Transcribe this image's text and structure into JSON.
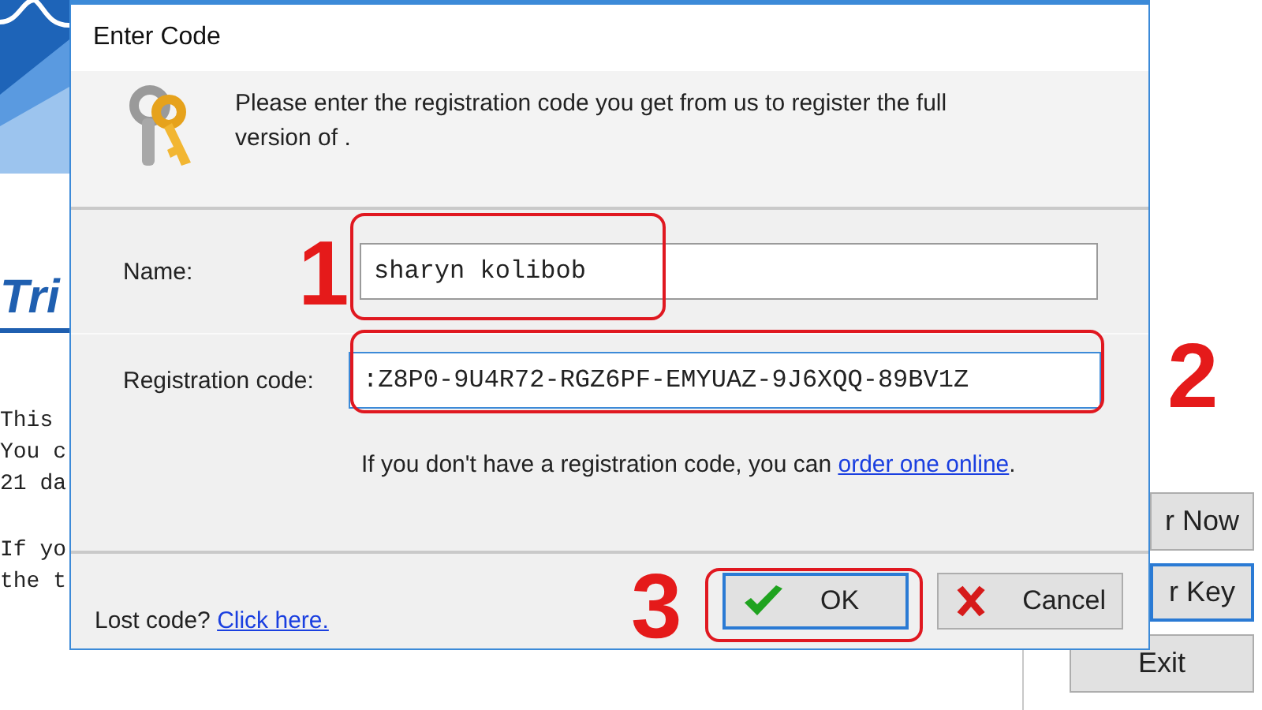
{
  "background_window": {
    "heading": "Tri",
    "text_lines": [
      "This",
      "You c",
      "21 da",
      "If yo",
      "the t"
    ],
    "buttons": [
      {
        "label": "r Now",
        "focused": false
      },
      {
        "label": "r Key",
        "focused": true
      },
      {
        "label": "Exit",
        "focused": false
      }
    ]
  },
  "dialog": {
    "title": "Enter Code",
    "message": "Please enter the registration code you get from us to register the full version of .",
    "fields": [
      {
        "label": "Name:",
        "value": "sharyn kolibob",
        "focused": false
      },
      {
        "label": "Registration code:",
        "value": ":Z8P0-9U4R72-RGZ6PF-EMYUAZ-9J6XQQ-89BV1Z",
        "focused": true
      }
    ],
    "help": {
      "text": "If you don't have a registration code, you can",
      "link": "order one online",
      "end": "."
    },
    "lost_code": {
      "text": "Lost code?",
      "link": "Click here."
    },
    "buttons": [
      {
        "label": "OK",
        "kind": "ok",
        "default": true
      },
      {
        "label": "Cancel",
        "kind": "cancel",
        "default": false
      }
    ]
  },
  "annotations": [
    {
      "label": "1"
    },
    {
      "label": "2"
    },
    {
      "label": "3"
    }
  ]
}
